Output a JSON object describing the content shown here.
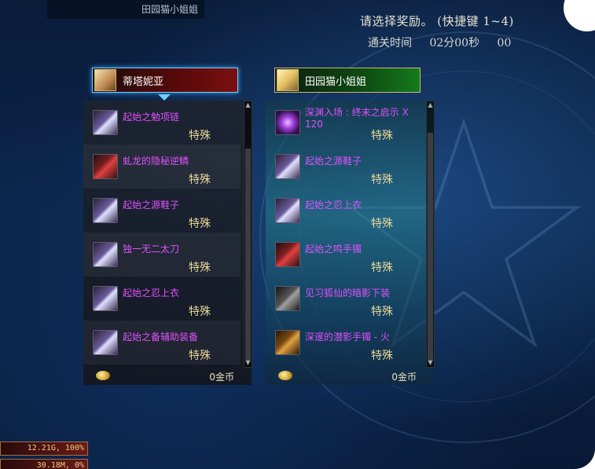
{
  "topbar": {
    "text": "田园猫小姐姐"
  },
  "prompt": "请选择奖励。 (快捷键 1~4)",
  "clear_time": {
    "label": "通关时间",
    "minsec": "02分00秒",
    "ms": "00"
  },
  "left_player": {
    "name": "蒂塔妮亚",
    "items": [
      {
        "name": "起始之勉项链",
        "tag": "特殊",
        "icon": "necklace-icon"
      },
      {
        "name": "虬龙的隐秘逆鳞",
        "tag": "特殊",
        "icon": "dragon-scale-icon"
      },
      {
        "name": "起始之源鞋子",
        "tag": "特殊",
        "icon": "shoes-icon"
      },
      {
        "name": "独一无二太刀",
        "tag": "特殊",
        "icon": "katana-icon"
      },
      {
        "name": "起始之忍上衣",
        "tag": "特殊",
        "icon": "coat-icon"
      },
      {
        "name": "起始之备辅助装备",
        "tag": "特殊",
        "icon": "support-equip-icon"
      }
    ],
    "gold": "0金币"
  },
  "right_player": {
    "name": "田园猫小姐姐",
    "items": [
      {
        "name": "深渊入场 : 终末之启示 X 120",
        "tag": "特殊",
        "icon": "abyss-ticket-icon"
      },
      {
        "name": "起始之源鞋子",
        "tag": "特殊",
        "icon": "shoes-icon"
      },
      {
        "name": "起始之忍上衣",
        "tag": "特殊",
        "icon": "coat-icon"
      },
      {
        "name": "起始之鸣手镯",
        "tag": "特殊",
        "icon": "bracelet-icon"
      },
      {
        "name": "见习狐仙的暗影下装",
        "tag": "特殊",
        "icon": "pants-icon"
      },
      {
        "name": "深邃的潜影手镯 - 火",
        "tag": "特殊",
        "icon": "fire-bracelet-icon"
      }
    ],
    "gold": "0金币"
  },
  "stats": [
    "12.21G, 100%",
    "30.18M, 0%"
  ],
  "colors": {
    "item_name": "#e050ff",
    "tag": "#e9d79a",
    "left_header": "#7a1010",
    "right_header": "#157a1c"
  }
}
